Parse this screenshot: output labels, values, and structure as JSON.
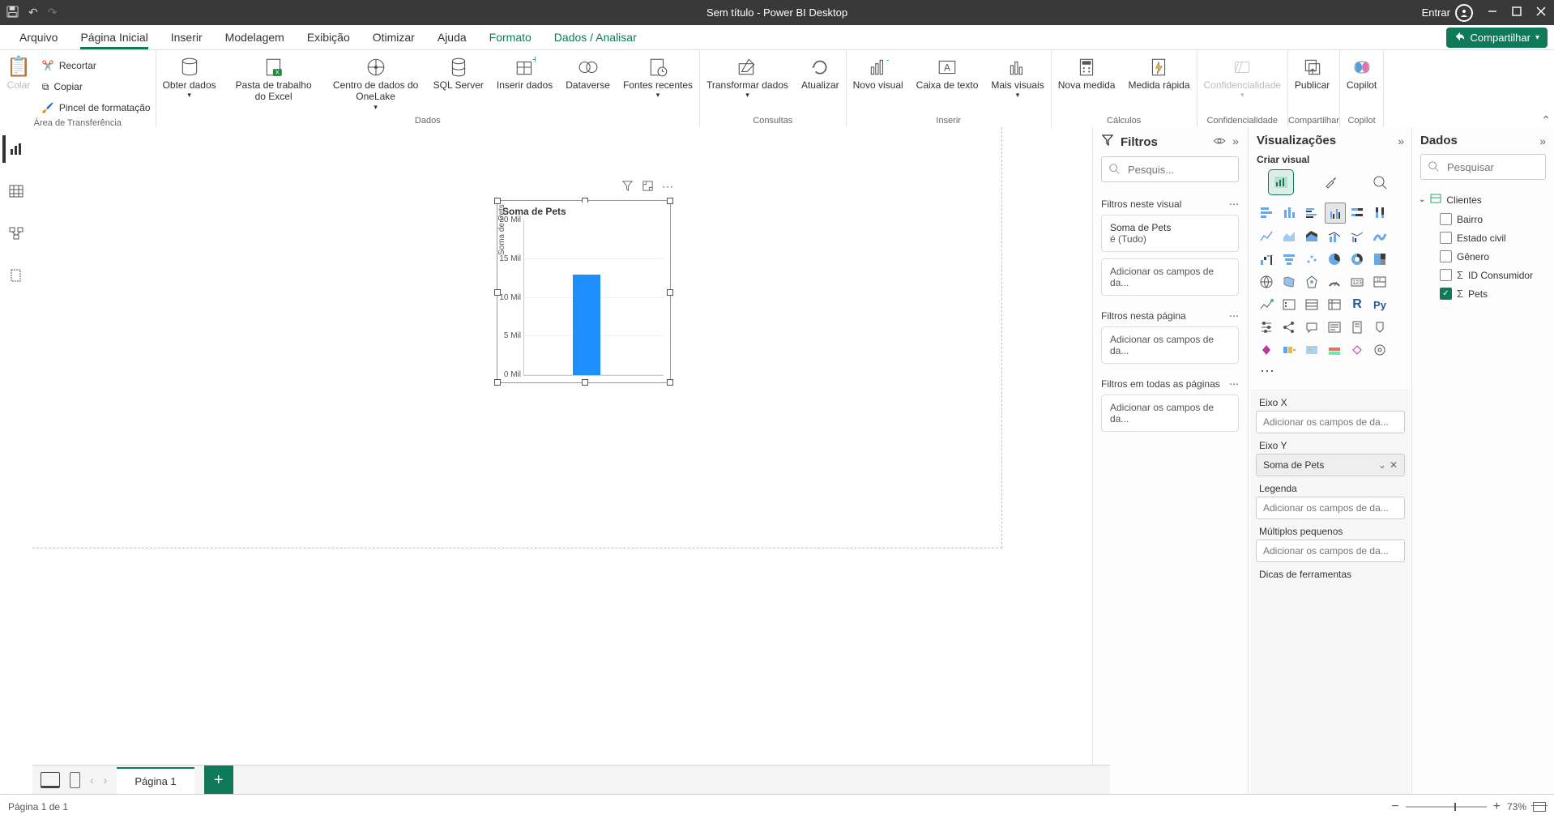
{
  "app_title": "Sem título - Power BI Desktop",
  "qat": {
    "save": "💾",
    "undo": "↶",
    "redo": "↷"
  },
  "signin_label": "Entrar",
  "ribbon_tabs": {
    "file": "Arquivo",
    "home": "Página Inicial",
    "insert": "Inserir",
    "modeling": "Modelagem",
    "view": "Exibição",
    "optimize": "Otimizar",
    "help": "Ajuda",
    "format": "Formato",
    "data_analyze": "Dados / Analisar"
  },
  "share_label": "Compartilhar",
  "ribbon": {
    "clipboard": {
      "group": "Área de Transferência",
      "paste": "Colar",
      "cut": "Recortar",
      "copy": "Copiar",
      "format_painter": "Pincel de formatação"
    },
    "data": {
      "group": "Dados",
      "get_data": "Obter dados",
      "excel": "Pasta de trabalho do Excel",
      "onelake": "Centro de dados do OneLake",
      "sql": "SQL Server",
      "enter": "Inserir dados",
      "dataverse": "Dataverse",
      "recent": "Fontes recentes"
    },
    "queries": {
      "group": "Consultas",
      "transform": "Transformar dados",
      "refresh": "Atualizar"
    },
    "insert": {
      "group": "Inserir",
      "new_visual": "Novo visual",
      "text_box": "Caixa de texto",
      "more_visuals": "Mais visuais"
    },
    "calcs": {
      "group": "Cálculos",
      "new_measure": "Nova medida",
      "quick_measure": "Medida rápida"
    },
    "sens": {
      "group": "Confidencialidade",
      "label": "Confidencialidade"
    },
    "share": {
      "group": "Compartilhar",
      "publish": "Publicar"
    },
    "copilot": {
      "group": "Copilot",
      "label": "Copilot"
    }
  },
  "page_tabs": {
    "page1": "Página 1"
  },
  "statusbar": {
    "page_counter": "Página 1 de 1",
    "zoom": "73%"
  },
  "chart_data": {
    "type": "bar",
    "categories": [
      ""
    ],
    "values": [
      13
    ],
    "title": "Soma de Pets",
    "ylabel": "Soma de Pets",
    "ylim": [
      0,
      20
    ],
    "yticks": {
      "0": "0 Mil",
      "5": "5 Mil",
      "10": "10 Mil",
      "15": "15 Mil",
      "20": "20 Mil"
    }
  },
  "filters": {
    "title": "Filtros",
    "search_placeholder": "Pesquis...",
    "on_visual": "Filtros neste visual",
    "on_page": "Filtros nesta página",
    "on_all": "Filtros em todas as páginas",
    "card_field": "Soma de Pets",
    "card_cond": "é (Tudo)",
    "add_fields": "Adicionar os campos de da..."
  },
  "viz": {
    "title": "Visualizações",
    "subtitle": "Criar visual",
    "wells": {
      "x": "Eixo X",
      "y": "Eixo Y",
      "y_value": "Soma de Pets",
      "legend": "Legenda",
      "small_mult": "Múltiplos pequenos",
      "tooltips": "Dicas de ferramentas",
      "add": "Adicionar os campos de da..."
    }
  },
  "data_pane": {
    "title": "Dados",
    "search_placeholder": "Pesquisar",
    "table": "Clientes",
    "fields": {
      "bairro": "Bairro",
      "estado_civil": "Estado civil",
      "genero": "Gênero",
      "id_consumidor": "ID Consumidor",
      "pets": "Pets"
    }
  }
}
